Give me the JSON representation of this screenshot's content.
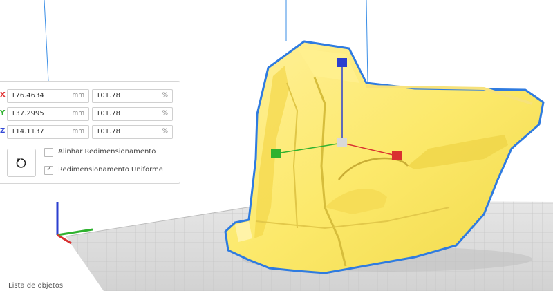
{
  "scale_tool": {
    "rows": [
      {
        "axis": "X",
        "axis_color": "#e03030",
        "size": "176.4634",
        "size_unit": "mm",
        "percent": "101.78",
        "percent_unit": "%"
      },
      {
        "axis": "Y",
        "axis_color": "#2fb22f",
        "size": "137.2995",
        "size_unit": "mm",
        "percent": "101.78",
        "percent_unit": "%"
      },
      {
        "axis": "Z",
        "axis_color": "#3248d6",
        "size": "114.1137",
        "size_unit": "mm",
        "percent": "101.78",
        "percent_unit": "%"
      }
    ],
    "reset_icon": "reset-rotate-icon",
    "snap_scaling": {
      "label": "Alinhar Redimensionamento",
      "checked": false
    },
    "uniform_scaling": {
      "label": "Redimensionamento Uniforme",
      "checked": true
    }
  },
  "footer": {
    "object_list_label": "Lista de objetos"
  },
  "colors": {
    "model_fill": "#fce96b",
    "model_outline": "#2f7be0",
    "build_plate": "#d9d9d9",
    "grid_lines": "#c4c4c4",
    "axis_x": "#d93030",
    "axis_y": "#2fb22f",
    "axis_z": "#2b3fcf"
  }
}
